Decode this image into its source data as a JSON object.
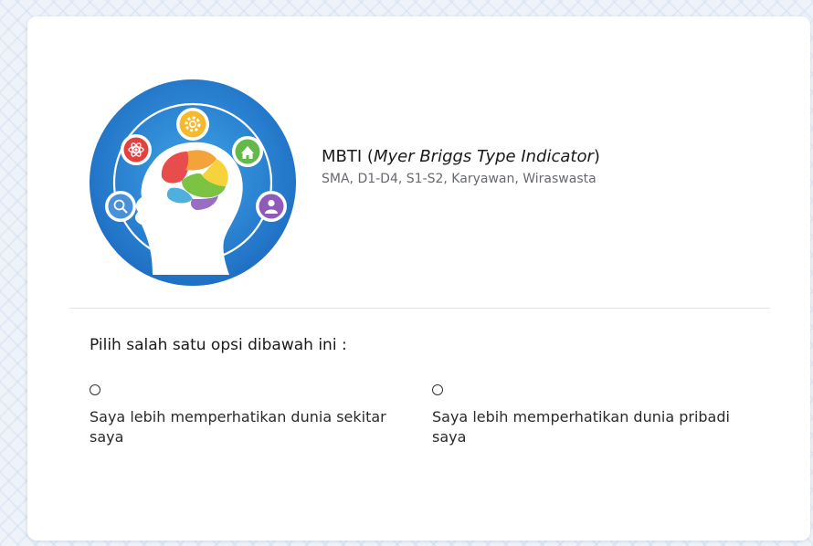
{
  "test": {
    "name": "MBTI",
    "full_name": "Myer Briggs Type Indicator",
    "audience": "SMA, D1-D4, S1-S2, Karyawan, Wiraswasta"
  },
  "question": {
    "prompt": "Pilih salah satu opsi dibawah ini :"
  },
  "options": [
    {
      "label": "Saya lebih memperhatikan dunia sekitar saya",
      "selected": false
    },
    {
      "label": "Saya lebih memperhatikan dunia pribadi saya",
      "selected": false
    }
  ],
  "logo": {
    "icons": [
      "atom-icon",
      "gear-icon",
      "school-icon",
      "search-icon",
      "person-icon",
      "brain-icon"
    ]
  }
}
